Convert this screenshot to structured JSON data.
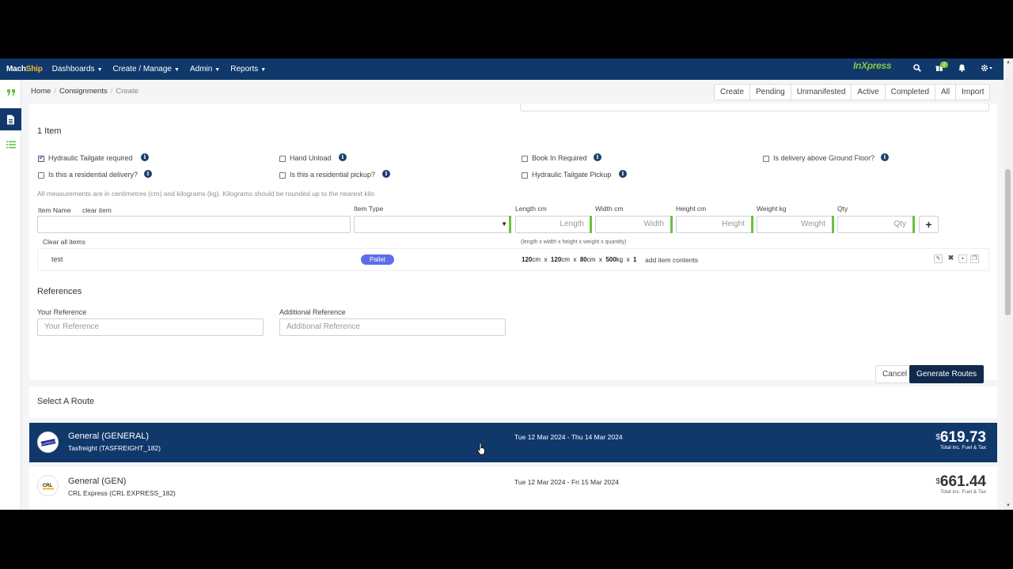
{
  "brand": {
    "logo_a": "Mach",
    "logo_b": "Ship",
    "partner": "InXpress"
  },
  "nav": {
    "menus": [
      "Dashboards",
      "Create / Manage",
      "Admin",
      "Reports"
    ],
    "notification_count": "2",
    "icons": [
      "search-icon",
      "gift-icon",
      "bell-icon",
      "gear-icon"
    ]
  },
  "breadcrumb": {
    "home": "Home",
    "consignments": "Consignments",
    "current": "Create"
  },
  "tabs": [
    "Create",
    "Pending",
    "Unmanifested",
    "Active",
    "Completed",
    "All",
    "Import"
  ],
  "items_section": {
    "title": "1 Item",
    "checkboxes": [
      {
        "label": "Hydraulic Tailgate required",
        "checked": true
      },
      {
        "label": "Hand Unload",
        "checked": false
      },
      {
        "label": "Book In Required",
        "checked": false
      },
      {
        "label": "Is delivery above Ground Floor?",
        "checked": false
      },
      {
        "label": "Is this a residential delivery?",
        "checked": false
      },
      {
        "label": "Is this a residential pickup?",
        "checked": false
      },
      {
        "label": "Hydraulic Tailgate Pickup",
        "checked": false
      }
    ],
    "measure_note": "All measurements are in centimetres (cm) and kilograms (kg). Kilograms should be rounded up to the nearest kilo",
    "labels": {
      "item_name": "Item Name",
      "clear_item": "clear item",
      "item_type": "Item Type",
      "length": "Length cm",
      "width": "Width cm",
      "height": "Height cm",
      "weight": "Weight kg",
      "qty": "Qty"
    },
    "placeholders": {
      "length": "Length",
      "width": "Width",
      "height": "Height",
      "weight": "Weight",
      "qty": "Qty"
    },
    "add_label": "+",
    "clear_all": "Clear all items",
    "formula": "(length x  width x  height x  weight x  quantity)",
    "item": {
      "name": "test",
      "type": "Pallet",
      "length": "120",
      "width": "120",
      "height": "80",
      "weight": "500",
      "qty": "1",
      "add_contents": "add item contents"
    }
  },
  "references": {
    "title": "References",
    "your_label": "Your Reference",
    "your_placeholder": "Your Reference",
    "additional_label": "Additional Reference",
    "additional_placeholder": "Additional Reference"
  },
  "actions": {
    "cancel": "Cancel",
    "generate": "Generate Routes"
  },
  "routes_section": {
    "title": "Select A Route"
  },
  "routes": [
    {
      "service": "General (GENERAL)",
      "carrier": "Tasfreight (TASFREIGHT_182)",
      "dates": "Tue 12 Mar 2024 - Thu 14 Mar 2024",
      "currency": "$",
      "price": "619.73",
      "price_note": "Total inc. Fuel & Tax",
      "logo_text": "TASFREIGHT",
      "selected": true
    },
    {
      "service": "General (GEN)",
      "carrier": "CRL Express (CRL EXPRESS_182)",
      "dates": "Tue 12 Mar 2024 - Fri 15 Mar 2024",
      "currency": "$",
      "price": "661.44",
      "price_note": "Total inc. Fuel & Tax",
      "logo_text": "CRL",
      "selected": false
    }
  ],
  "colors": {
    "navbar": "#10386b",
    "accent_green": "#6ac043",
    "pill": "#5c6ee8",
    "primary_button": "#10294d"
  }
}
